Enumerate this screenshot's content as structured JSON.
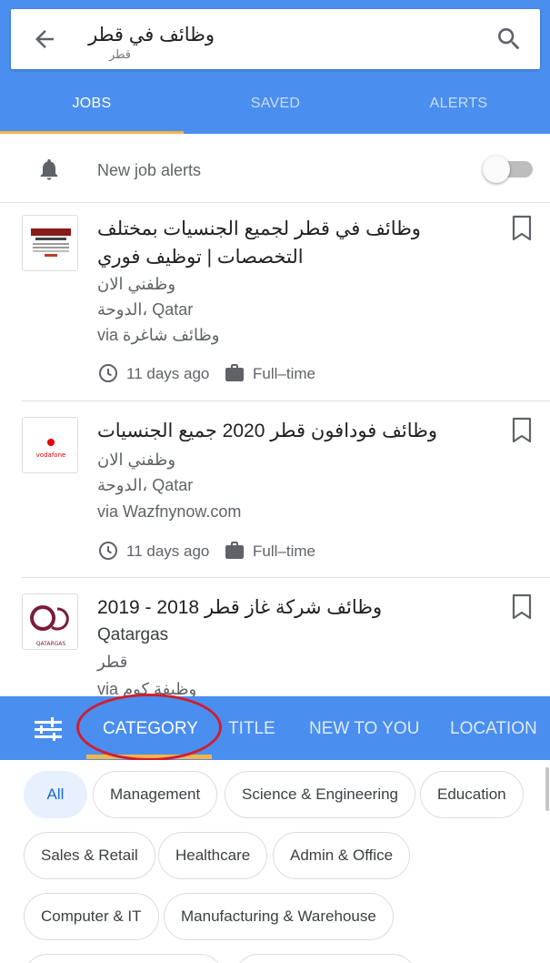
{
  "search": {
    "query": "وظائف في قطر",
    "location_hint": "قطر"
  },
  "tabs": [
    {
      "label": "JOBS",
      "active": true
    },
    {
      "label": "SAVED",
      "active": false
    },
    {
      "label": "ALERTS",
      "active": false
    }
  ],
  "alerts": {
    "label": "New job alerts",
    "toggle_on": false
  },
  "jobs": [
    {
      "title": "وظائف في قطر لجميع الجنسيات بمختلف التخصصات | توظيف فوري",
      "company": "وظفني الان",
      "location": "الدوحة، Qatar",
      "via": "via وظائف شاغرة",
      "posted": "11 days ago",
      "type": "Full–time"
    },
    {
      "title": "وظائف فودافون قطر 2020 جميع الجنسيات",
      "company": "وظفني الان",
      "location": "الدوحة، Qatar",
      "via": "via Wazfnynow.com",
      "posted": "11 days ago",
      "type": "Full–time",
      "logo_text": "vodafone"
    },
    {
      "title": "وظائف شركة غاز قطر 2018 - 2019",
      "company": "Qatargas",
      "location": "قطر",
      "via": "via وظيفة كوم",
      "logo_text": "QATARGAS"
    }
  ],
  "filter_tabs": [
    {
      "label": "CATEGORY",
      "active": true
    },
    {
      "label": "TITLE",
      "active": false
    },
    {
      "label": "NEW TO YOU",
      "active": false
    },
    {
      "label": "LOCATION",
      "active": false
    }
  ],
  "categories": [
    {
      "label": "All",
      "active": true
    },
    {
      "label": "Management"
    },
    {
      "label": "Science & Engineering"
    },
    {
      "label": "Education"
    },
    {
      "label": "Sales & Retail"
    },
    {
      "label": "Healthcare"
    },
    {
      "label": "Admin & Office"
    },
    {
      "label": "Computer & IT"
    },
    {
      "label": "Manufacturing & Warehouse"
    }
  ],
  "colors": {
    "brand_blue": "#4a8ef0",
    "tab_underline": "#f3b547",
    "annotation_red": "#d21d2b",
    "chip_active_bg": "#e8f0fe"
  },
  "icons": [
    "back-arrow-icon",
    "search-icon",
    "bell-icon",
    "bookmark-icon",
    "clock-icon",
    "briefcase-icon",
    "filter-sliders-icon"
  ]
}
